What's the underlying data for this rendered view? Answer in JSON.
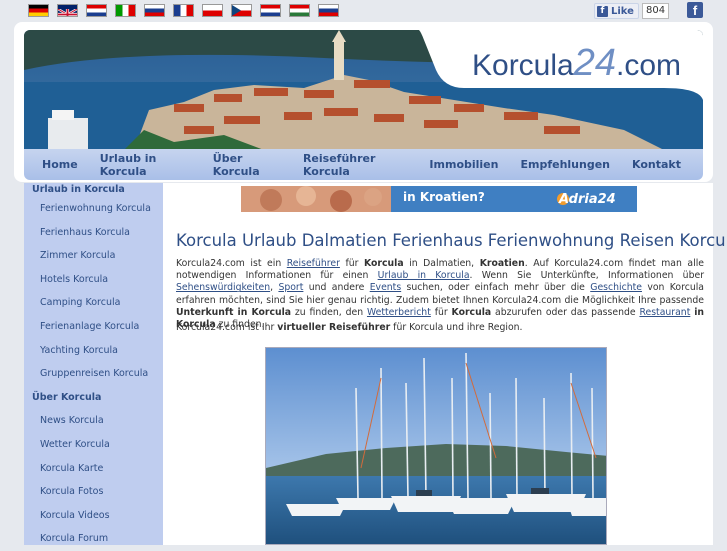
{
  "top": {
    "flags": [
      {
        "name": "flag-de",
        "title": "Deutsch"
      },
      {
        "name": "flag-gb",
        "title": "English"
      },
      {
        "name": "flag-hr",
        "title": "Hrvatski"
      },
      {
        "name": "flag-it",
        "title": "Italiano"
      },
      {
        "name": "flag-si",
        "title": "Slovenščina"
      },
      {
        "name": "flag-fr",
        "title": "Français"
      },
      {
        "name": "flag-pl",
        "title": "Polski"
      },
      {
        "name": "flag-cz",
        "title": "Čeština"
      },
      {
        "name": "flag-hr2",
        "title": "Hrvatski"
      },
      {
        "name": "flag-hu",
        "title": "Magyar"
      },
      {
        "name": "flag-ru",
        "title": "Русский"
      }
    ],
    "like_label": "Like",
    "like_count": "804",
    "fb_glyph": "f"
  },
  "header": {
    "logo_left": "Korcula",
    "logo_num": "24",
    "logo_right": ".com"
  },
  "nav": [
    "Home",
    "Urlaub in Korcula",
    "Über Korcula",
    "Reiseführer Korcula",
    "Immobilien",
    "Empfehlungen",
    "Kontakt"
  ],
  "sidebar": [
    {
      "label": "Urlaub in Korcula",
      "head": true
    },
    {
      "label": "Ferienwohnung Korcula"
    },
    {
      "label": "Ferienhaus Korcula"
    },
    {
      "label": "Zimmer Korcula"
    },
    {
      "label": "Hotels Korcula"
    },
    {
      "label": "Camping Korcula"
    },
    {
      "label": "Ferienanlage Korcula"
    },
    {
      "label": "Yachting Korcula"
    },
    {
      "label": "Gruppenreisen Korcula"
    },
    {
      "label": "Über Korcula",
      "head": true
    },
    {
      "label": "News Korcula"
    },
    {
      "label": "Wetter Korcula"
    },
    {
      "label": "Korcula Karte"
    },
    {
      "label": "Korcula Fotos"
    },
    {
      "label": "Korcula Videos"
    },
    {
      "label": "Korcula Forum"
    }
  ],
  "ad": {
    "text": "in Kroatien?",
    "brand": "Adria24"
  },
  "main": {
    "title": "Korcula Urlaub Dalmatien Ferienhaus Ferienwohnung Reisen Korcula",
    "para1": [
      {
        "t": "Korcula24.com ist ein "
      },
      {
        "a": "Reiseführer"
      },
      {
        "t": " für "
      },
      {
        "b": "Korcula"
      },
      {
        "t": " in Dalmatien, "
      },
      {
        "b": "Kroatien"
      },
      {
        "t": ". Auf Korcula24.com findet man alle notwendigen Informationen für einen "
      },
      {
        "a": "Urlaub in Korcula"
      },
      {
        "t": ". Wenn Sie Unterkünfte, Informationen über "
      },
      {
        "a": "Sehenswürdigkeiten"
      },
      {
        "t": ", "
      },
      {
        "a": "Sport"
      },
      {
        "t": " und andere "
      },
      {
        "a": "Events"
      },
      {
        "t": " suchen, oder einfach mehr über die "
      },
      {
        "a": "Geschichte"
      },
      {
        "t": " von Korcula erfahren möchten, sind Sie hier genau richtig. Zudem bietet Ihnen Korcula24.com die Möglichkeit Ihre passende "
      },
      {
        "b": "Unterkunft in Korcula"
      },
      {
        "t": " zu finden, den "
      },
      {
        "a": "Wetterbericht"
      },
      {
        "t": " für "
      },
      {
        "b": "Korcula"
      },
      {
        "t": " abzurufen oder das passende "
      },
      {
        "a": "Restaurant"
      },
      {
        "t": " "
      },
      {
        "b": "in Korcula"
      },
      {
        "t": " zu finden."
      }
    ],
    "para2_prefix": "Korcula24.com ist Ihr ",
    "para2_bold": "virtueller Reiseführer",
    "para2_suffix": " für Korcula und ihre Region."
  },
  "colors": {
    "accent": "#2f4f86",
    "nav_bg": "#b4c7ec",
    "sidebar_bg": "#bfcdef"
  }
}
